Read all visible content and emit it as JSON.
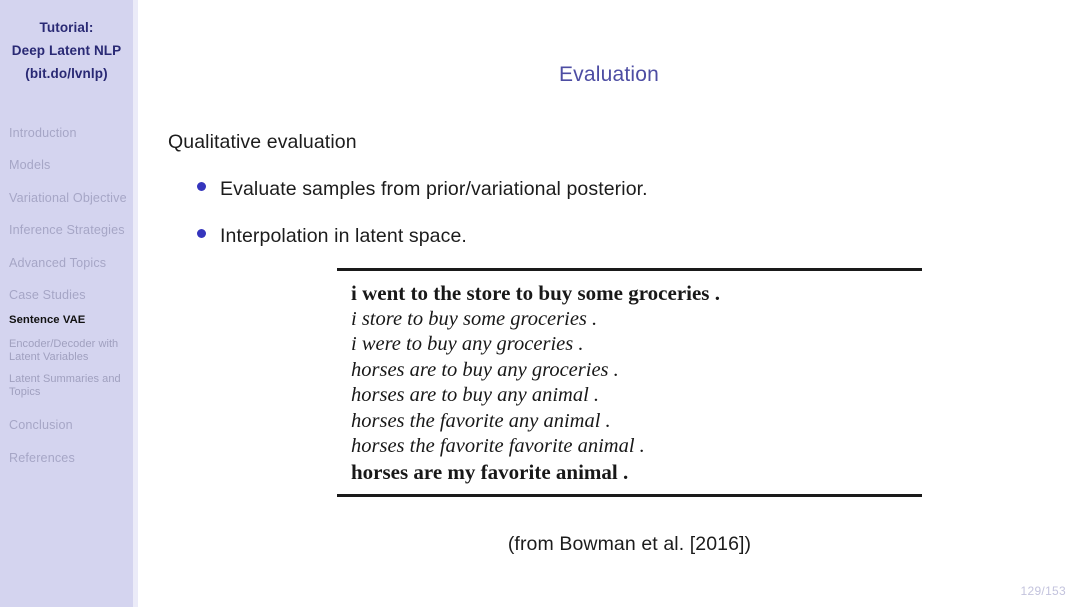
{
  "sidebar": {
    "background_color": "#d4d4ef",
    "title_color": "#292974",
    "inactive_color": "#a6a6c6",
    "title_lines": [
      "Tutorial:",
      "Deep Latent NLP",
      "(bit.do/lvnlp)"
    ],
    "sections": [
      {
        "label": "Introduction",
        "active": false
      },
      {
        "label": "Models",
        "active": false
      },
      {
        "label": "Variational Objective",
        "active": false
      },
      {
        "label": "Inference Strategies",
        "active": false
      },
      {
        "label": "Advanced Topics",
        "active": false
      },
      {
        "label": "Case Studies",
        "active": true
      }
    ],
    "case_studies_subitems": [
      {
        "label": "Sentence VAE",
        "current": true
      },
      {
        "label": "Encoder/Decoder with Latent Variables",
        "current": false
      },
      {
        "label": "Latent Summaries and Topics",
        "current": false
      }
    ],
    "trailing_sections": [
      {
        "label": "Conclusion",
        "active": false
      },
      {
        "label": "References",
        "active": false
      }
    ]
  },
  "main": {
    "title": "Evaluation",
    "title_color": "#4d4da3",
    "lead_line": "Qualitative evaluation",
    "bullet_color": "#3535bd",
    "bullets": [
      "Evaluate samples from prior/variational posterior.",
      "Interpolation in latent space."
    ],
    "figure": {
      "caption": "(from Bowman et al. [2016])",
      "lines": [
        {
          "text": "i went to the store to buy some groceries .",
          "style": "endpoint"
        },
        {
          "text": "i store to buy some groceries .",
          "style": "interpolated"
        },
        {
          "text": "i were to buy any groceries .",
          "style": "interpolated"
        },
        {
          "text": "horses are to buy any groceries .",
          "style": "interpolated"
        },
        {
          "text": "horses are to buy any animal .",
          "style": "interpolated"
        },
        {
          "text": "horses the favorite any animal .",
          "style": "interpolated"
        },
        {
          "text": "horses the favorite favorite animal .",
          "style": "interpolated"
        },
        {
          "text": "horses are my favorite animal .",
          "style": "endpoint"
        }
      ]
    }
  },
  "footer": {
    "page_number": "129/153",
    "page_number_color": "#c3c3dd"
  }
}
